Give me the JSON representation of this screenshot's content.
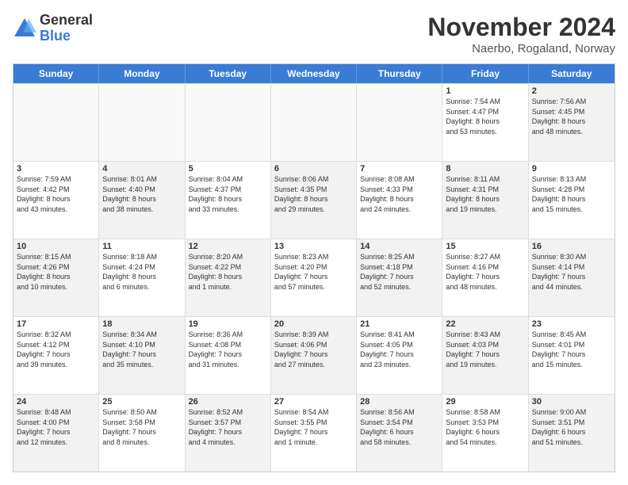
{
  "logo": {
    "general": "General",
    "blue": "Blue"
  },
  "title": "November 2024",
  "location": "Naerbo, Rogaland, Norway",
  "header_days": [
    "Sunday",
    "Monday",
    "Tuesday",
    "Wednesday",
    "Thursday",
    "Friday",
    "Saturday"
  ],
  "rows": [
    [
      {
        "day": "",
        "text": "",
        "empty": true
      },
      {
        "day": "",
        "text": "",
        "empty": true
      },
      {
        "day": "",
        "text": "",
        "empty": true
      },
      {
        "day": "",
        "text": "",
        "empty": true
      },
      {
        "day": "",
        "text": "",
        "empty": true
      },
      {
        "day": "1",
        "text": "Sunrise: 7:54 AM\nSunset: 4:47 PM\nDaylight: 8 hours\nand 53 minutes.",
        "empty": false
      },
      {
        "day": "2",
        "text": "Sunrise: 7:56 AM\nSunset: 4:45 PM\nDaylight: 8 hours\nand 48 minutes.",
        "empty": false,
        "shaded": true
      }
    ],
    [
      {
        "day": "3",
        "text": "Sunrise: 7:59 AM\nSunset: 4:42 PM\nDaylight: 8 hours\nand 43 minutes.",
        "empty": false
      },
      {
        "day": "4",
        "text": "Sunrise: 8:01 AM\nSunset: 4:40 PM\nDaylight: 8 hours\nand 38 minutes.",
        "empty": false,
        "shaded": true
      },
      {
        "day": "5",
        "text": "Sunrise: 8:04 AM\nSunset: 4:37 PM\nDaylight: 8 hours\nand 33 minutes.",
        "empty": false
      },
      {
        "day": "6",
        "text": "Sunrise: 8:06 AM\nSunset: 4:35 PM\nDaylight: 8 hours\nand 29 minutes.",
        "empty": false,
        "shaded": true
      },
      {
        "day": "7",
        "text": "Sunrise: 8:08 AM\nSunset: 4:33 PM\nDaylight: 8 hours\nand 24 minutes.",
        "empty": false
      },
      {
        "day": "8",
        "text": "Sunrise: 8:11 AM\nSunset: 4:31 PM\nDaylight: 8 hours\nand 19 minutes.",
        "empty": false,
        "shaded": true
      },
      {
        "day": "9",
        "text": "Sunrise: 8:13 AM\nSunset: 4:28 PM\nDaylight: 8 hours\nand 15 minutes.",
        "empty": false
      }
    ],
    [
      {
        "day": "10",
        "text": "Sunrise: 8:15 AM\nSunset: 4:26 PM\nDaylight: 8 hours\nand 10 minutes.",
        "empty": false,
        "shaded": true
      },
      {
        "day": "11",
        "text": "Sunrise: 8:18 AM\nSunset: 4:24 PM\nDaylight: 8 hours\nand 6 minutes.",
        "empty": false
      },
      {
        "day": "12",
        "text": "Sunrise: 8:20 AM\nSunset: 4:22 PM\nDaylight: 8 hours\nand 1 minute.",
        "empty": false,
        "shaded": true
      },
      {
        "day": "13",
        "text": "Sunrise: 8:23 AM\nSunset: 4:20 PM\nDaylight: 7 hours\nand 57 minutes.",
        "empty": false
      },
      {
        "day": "14",
        "text": "Sunrise: 8:25 AM\nSunset: 4:18 PM\nDaylight: 7 hours\nand 52 minutes.",
        "empty": false,
        "shaded": true
      },
      {
        "day": "15",
        "text": "Sunrise: 8:27 AM\nSunset: 4:16 PM\nDaylight: 7 hours\nand 48 minutes.",
        "empty": false
      },
      {
        "day": "16",
        "text": "Sunrise: 8:30 AM\nSunset: 4:14 PM\nDaylight: 7 hours\nand 44 minutes.",
        "empty": false,
        "shaded": true
      }
    ],
    [
      {
        "day": "17",
        "text": "Sunrise: 8:32 AM\nSunset: 4:12 PM\nDaylight: 7 hours\nand 39 minutes.",
        "empty": false
      },
      {
        "day": "18",
        "text": "Sunrise: 8:34 AM\nSunset: 4:10 PM\nDaylight: 7 hours\nand 35 minutes.",
        "empty": false,
        "shaded": true
      },
      {
        "day": "19",
        "text": "Sunrise: 8:36 AM\nSunset: 4:08 PM\nDaylight: 7 hours\nand 31 minutes.",
        "empty": false
      },
      {
        "day": "20",
        "text": "Sunrise: 8:39 AM\nSunset: 4:06 PM\nDaylight: 7 hours\nand 27 minutes.",
        "empty": false,
        "shaded": true
      },
      {
        "day": "21",
        "text": "Sunrise: 8:41 AM\nSunset: 4:05 PM\nDaylight: 7 hours\nand 23 minutes.",
        "empty": false
      },
      {
        "day": "22",
        "text": "Sunrise: 8:43 AM\nSunset: 4:03 PM\nDaylight: 7 hours\nand 19 minutes.",
        "empty": false,
        "shaded": true
      },
      {
        "day": "23",
        "text": "Sunrise: 8:45 AM\nSunset: 4:01 PM\nDaylight: 7 hours\nand 15 minutes.",
        "empty": false
      }
    ],
    [
      {
        "day": "24",
        "text": "Sunrise: 8:48 AM\nSunset: 4:00 PM\nDaylight: 7 hours\nand 12 minutes.",
        "empty": false,
        "shaded": true
      },
      {
        "day": "25",
        "text": "Sunrise: 8:50 AM\nSunset: 3:58 PM\nDaylight: 7 hours\nand 8 minutes.",
        "empty": false
      },
      {
        "day": "26",
        "text": "Sunrise: 8:52 AM\nSunset: 3:57 PM\nDaylight: 7 hours\nand 4 minutes.",
        "empty": false,
        "shaded": true
      },
      {
        "day": "27",
        "text": "Sunrise: 8:54 AM\nSunset: 3:55 PM\nDaylight: 7 hours\nand 1 minute.",
        "empty": false
      },
      {
        "day": "28",
        "text": "Sunrise: 8:56 AM\nSunset: 3:54 PM\nDaylight: 6 hours\nand 58 minutes.",
        "empty": false,
        "shaded": true
      },
      {
        "day": "29",
        "text": "Sunrise: 8:58 AM\nSunset: 3:53 PM\nDaylight: 6 hours\nand 54 minutes.",
        "empty": false
      },
      {
        "day": "30",
        "text": "Sunrise: 9:00 AM\nSunset: 3:51 PM\nDaylight: 6 hours\nand 51 minutes.",
        "empty": false,
        "shaded": true
      }
    ]
  ]
}
